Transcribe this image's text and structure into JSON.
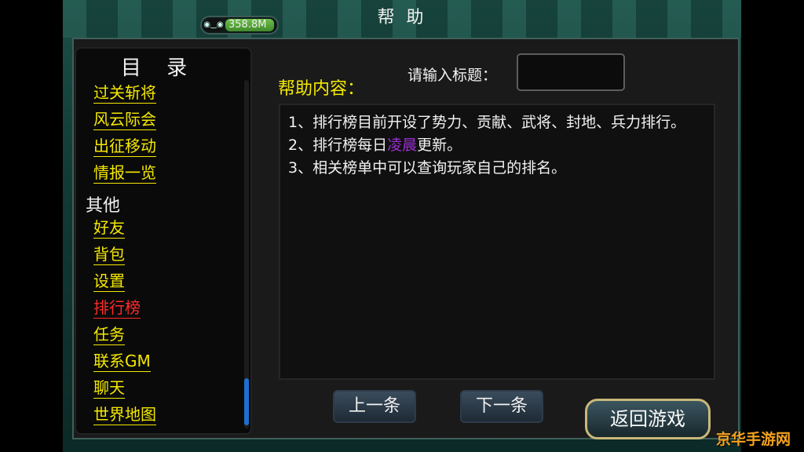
{
  "window": {
    "title": "帮 助"
  },
  "memory": {
    "value_label": "358.8M",
    "fill_fraction": 0.9,
    "icon": "eye-icon"
  },
  "sidebar": {
    "title": "目 录",
    "items_top": [
      {
        "label": "过关斩将"
      },
      {
        "label": "风云际会"
      },
      {
        "label": "出征移动"
      },
      {
        "label": "情报一览"
      }
    ],
    "section_other": "其他",
    "items_other": [
      {
        "label": "好友",
        "active": false
      },
      {
        "label": "背包",
        "active": false
      },
      {
        "label": "设置",
        "active": false
      },
      {
        "label": "排行榜",
        "active": true
      },
      {
        "label": "任务",
        "active": false
      },
      {
        "label": "联系GM",
        "active": false
      },
      {
        "label": "聊天",
        "active": false
      },
      {
        "label": "世界地图",
        "active": false
      }
    ]
  },
  "main": {
    "help_label": "帮助内容：",
    "search_label": "请输入标题：",
    "search_value": "",
    "content": {
      "line1": "1、排行榜目前开设了势力、贡献、武将、封地、兵力排行。",
      "line2_prefix": "2、排行榜每日",
      "line2_highlight": "凌晨",
      "line2_suffix": "更新。",
      "line3": "3、相关榜单中可以查询玩家自己的排名。"
    },
    "prev_button": "上一条",
    "next_button": "下一条",
    "return_button": "返回游戏"
  },
  "watermark": "京华手游网",
  "colors": {
    "link_yellow": "#f4e800",
    "active_red": "#ff2a2a",
    "highlight_purple": "#9a2fd2",
    "watermark_orange": "#f4a21e"
  }
}
